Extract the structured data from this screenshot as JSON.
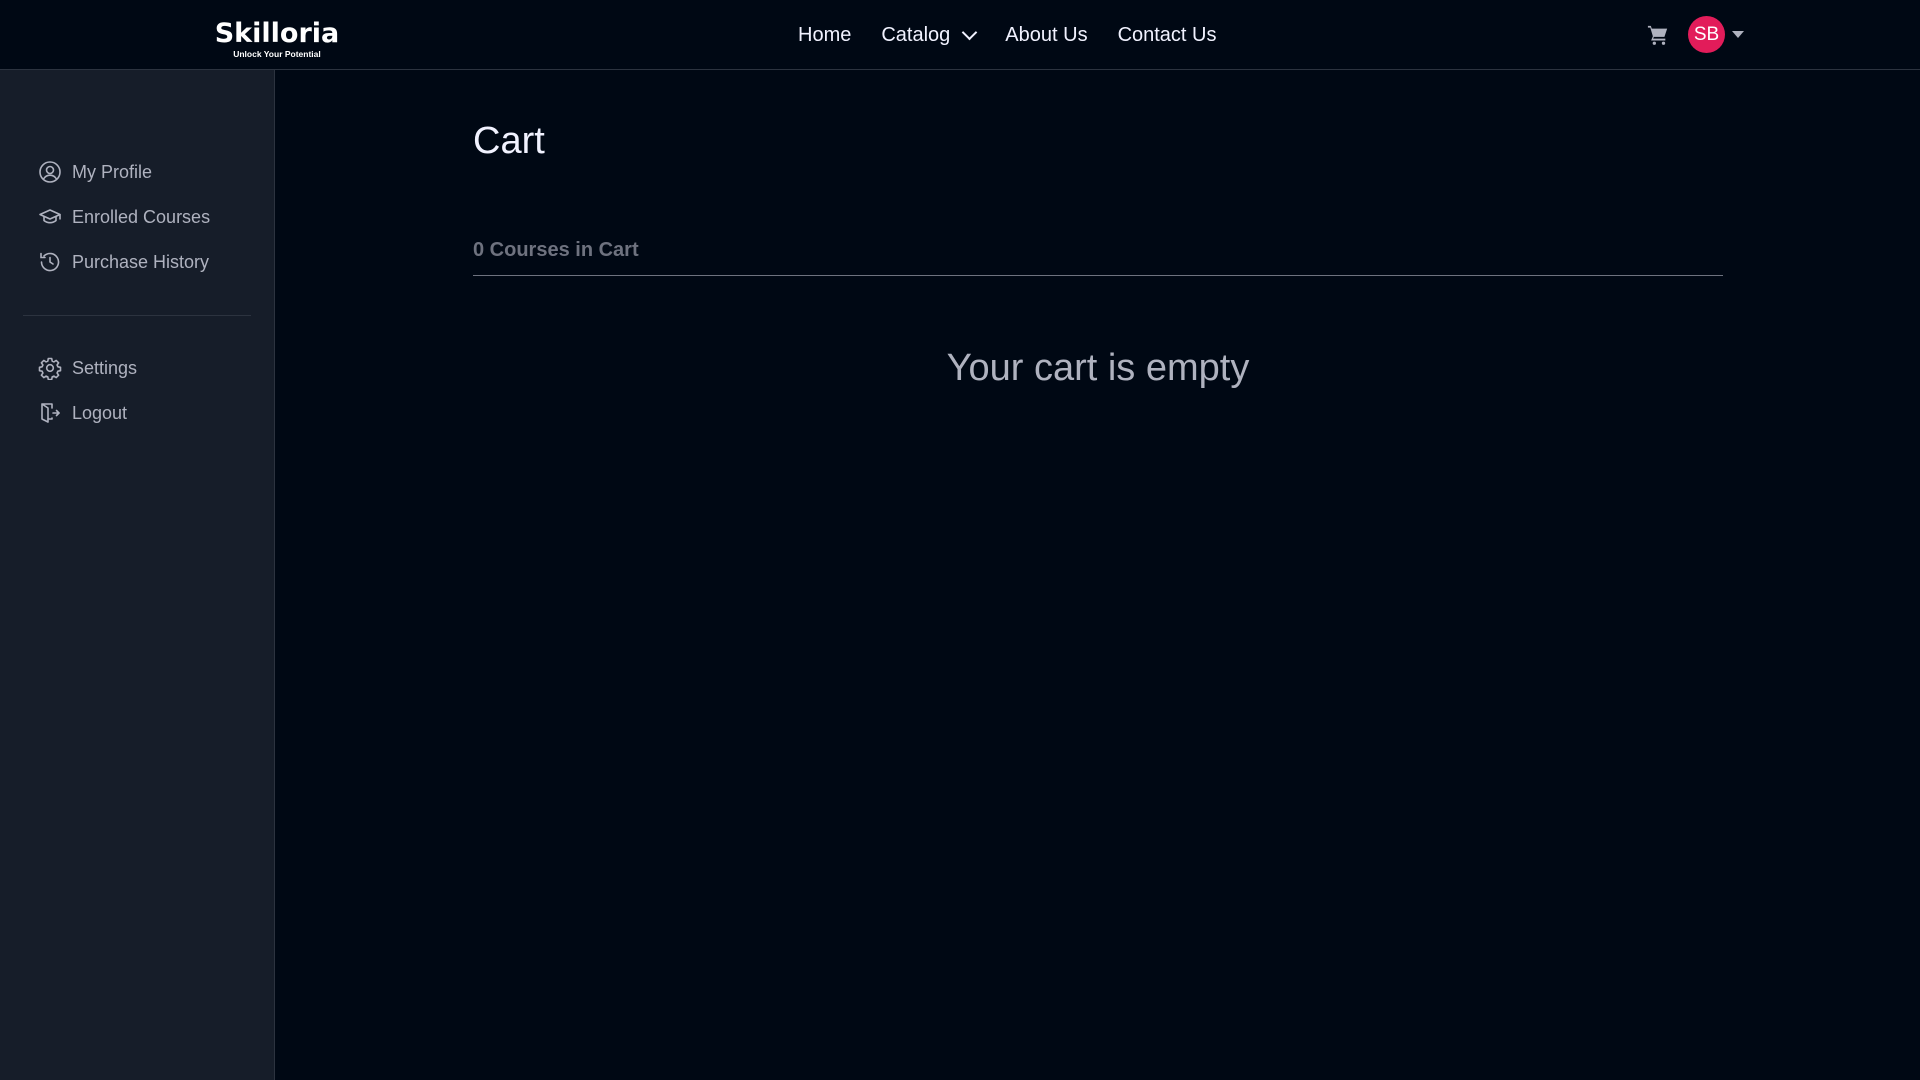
{
  "brand": {
    "name": "Skilloria",
    "tagline": "Unlock Your Potential"
  },
  "nav": {
    "links": [
      {
        "label": "Home"
      },
      {
        "label": "Catalog",
        "icon": "chevron-down-icon"
      },
      {
        "label": "About Us"
      },
      {
        "label": "Contact Us"
      }
    ],
    "cart_icon": "cart-icon",
    "avatar_initials": "SB",
    "avatar_color": "#E21C5A"
  },
  "sidebar": {
    "items": [
      {
        "label": "My Profile",
        "icon": "user-circle-icon"
      },
      {
        "label": "Enrolled Courses",
        "icon": "graduation-cap-icon"
      },
      {
        "label": "Purchase History",
        "icon": "history-icon"
      }
    ],
    "bottom_items": [
      {
        "label": "Settings",
        "icon": "gear-icon"
      },
      {
        "label": "Logout",
        "icon": "logout-icon"
      }
    ]
  },
  "main": {
    "title": "Cart",
    "cart_count": "0 Courses in Cart",
    "empty_message": "Your cart is empty"
  },
  "colors": {
    "background": "#000814",
    "sidebar": "#161D29",
    "text_primary": "#F1F2FF",
    "text_muted": "#AFB2BF",
    "divider": "#2C333F"
  }
}
